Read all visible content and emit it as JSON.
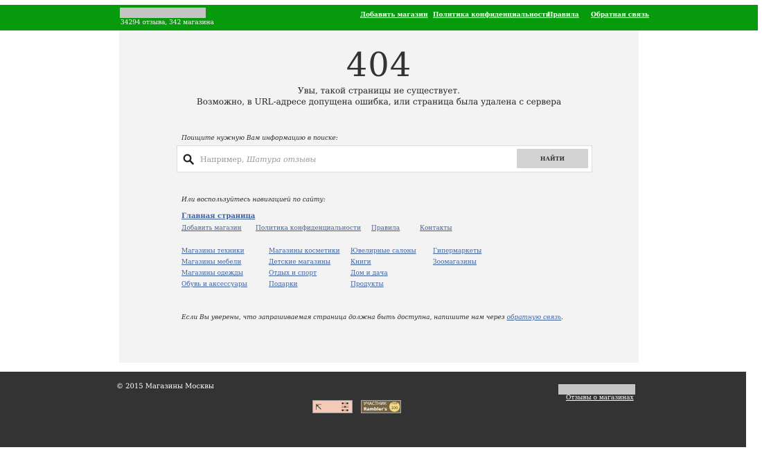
{
  "header": {
    "stats": "34294 отзыва, 342 магазина",
    "nav": [
      "Добавить магазин",
      "Политика конфиденциальности",
      "Правила",
      "Обратная связь"
    ]
  },
  "error": {
    "code": "404",
    "line1": "Увы, такой страницы не существует.",
    "line2": "Возможно, в URL-адресе допущена ошибка, или страница была удалена с сервера"
  },
  "search": {
    "label": "Поищите нужную Вам информацию в поиске:",
    "placeholder_prefix": "Например, ",
    "placeholder_example": "Шатура отзывы",
    "button": "НАЙТИ",
    "icon": "search-icon"
  },
  "site_nav": {
    "label": "Или воспользуйтесь навигацией по сайту:",
    "main_link": "Главная страница",
    "service_links": [
      "Добавить магазин",
      "Политика конфиденциальности",
      "Правила",
      "Контакты"
    ],
    "categories": [
      [
        "Магазины техники",
        "Магазины косметики",
        "Ювелирные салоны",
        "Гипермаркеты"
      ],
      [
        "Магазины мебели",
        "Детские магазины",
        "Книги",
        "Зоомагазины"
      ],
      [
        "Магазины одежды",
        "Отдых и спорт",
        "Дом и дача"
      ],
      [
        "Обувь и аксессуары",
        "Подарки",
        "Продукты"
      ]
    ]
  },
  "confirm": {
    "text": "Если Вы уверены, что запрашиваемая страница должна быть доступна, напишите нам через ",
    "link": "обратную связь",
    "end": "."
  },
  "footer": {
    "copyright": "© 2015 Магазины Москвы",
    "link": "Отзывы о магазинах",
    "counter1_glyph": "⇱",
    "counter1_mini": "▪▫▪ ▫▪▫ ▪▫▪",
    "counter2_line1": "УЧАСТНИК",
    "counter2_line2": "Rambler's",
    "counter2_badge": "TOP 100"
  },
  "colors": {
    "header_bg": "#079a0c",
    "panel_bg": "#f3f3f3",
    "footer_bg": "#333333",
    "link": "#3d5f9a"
  }
}
